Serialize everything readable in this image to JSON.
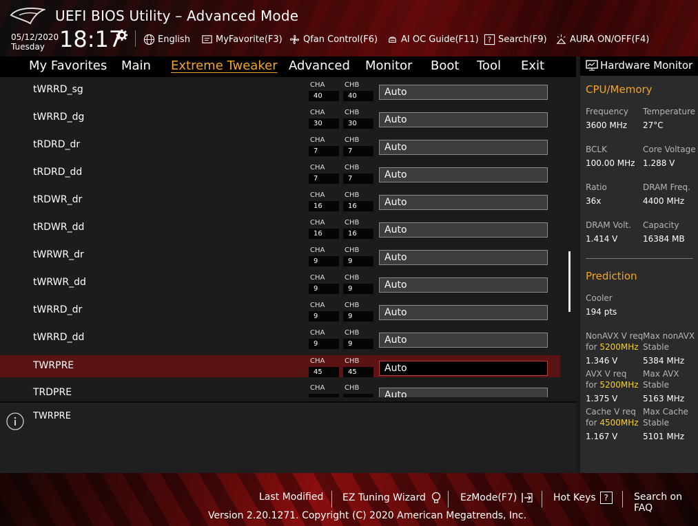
{
  "header": {
    "title": "UEFI BIOS Utility – Advanced Mode",
    "date": "05/12/2020",
    "day": "Tuesday",
    "time": "18:17",
    "toolbar": [
      {
        "label": "English",
        "icon": "globe-icon"
      },
      {
        "label": "MyFavorite(F3)",
        "icon": "favorite-icon"
      },
      {
        "label": "Qfan Control(F6)",
        "icon": "fan-icon"
      },
      {
        "label": "AI OC Guide(F11)",
        "icon": "ai-oc-icon"
      },
      {
        "label": "Search(F9)",
        "icon": "search-help-icon"
      },
      {
        "label": "AURA ON/OFF(F4)",
        "icon": "aura-icon"
      }
    ]
  },
  "menu": {
    "items": [
      "My Favorites",
      "Main",
      "Extreme Tweaker",
      "Advanced",
      "Monitor",
      "Boot",
      "Tool",
      "Exit"
    ],
    "active": "Extreme Tweaker"
  },
  "settings": {
    "cha_label": "CHA",
    "chb_label": "CHB",
    "rows": [
      {
        "name": "tWRRD_sg",
        "cha": "40",
        "chb": "40",
        "value": "Auto"
      },
      {
        "name": "tWRRD_dg",
        "cha": "30",
        "chb": "30",
        "value": "Auto"
      },
      {
        "name": "tRDRD_dr",
        "cha": "7",
        "chb": "7",
        "value": "Auto"
      },
      {
        "name": "tRDRD_dd",
        "cha": "7",
        "chb": "7",
        "value": "Auto"
      },
      {
        "name": "tRDWR_dr",
        "cha": "16",
        "chb": "16",
        "value": "Auto"
      },
      {
        "name": "tRDWR_dd",
        "cha": "16",
        "chb": "16",
        "value": "Auto"
      },
      {
        "name": "tWRWR_dr",
        "cha": "9",
        "chb": "9",
        "value": "Auto"
      },
      {
        "name": "tWRWR_dd",
        "cha": "9",
        "chb": "9",
        "value": "Auto"
      },
      {
        "name": "tWRRD_dr",
        "cha": "9",
        "chb": "9",
        "value": "Auto"
      },
      {
        "name": "tWRRD_dd",
        "cha": "9",
        "chb": "9",
        "value": "Auto"
      },
      {
        "name": "TWRPRE",
        "cha": "45",
        "chb": "45",
        "value": "Auto",
        "selected": true
      },
      {
        "name": "TRDPRE",
        "cha": "",
        "chb": "",
        "value": "Auto"
      }
    ]
  },
  "help": {
    "text": "TWRPRE"
  },
  "hardware_monitor": {
    "title": "Hardware Monitor",
    "cpu_memory": {
      "heading": "CPU/Memory",
      "items": [
        {
          "label": "Frequency",
          "value": "3600 MHz"
        },
        {
          "label": "Temperature",
          "value": "27°C"
        },
        {
          "label": "BCLK",
          "value": "100.00 MHz"
        },
        {
          "label": "Core Voltage",
          "value": "1.288 V"
        },
        {
          "label": "Ratio",
          "value": "36x"
        },
        {
          "label": "DRAM Freq.",
          "value": "4400 MHz"
        },
        {
          "label": "DRAM Volt.",
          "value": "1.414 V"
        },
        {
          "label": "Capacity",
          "value": "16384 MB"
        }
      ]
    },
    "prediction": {
      "heading": "Prediction",
      "cooler_label": "Cooler",
      "cooler_value": "194 pts",
      "nonavx_req_label": "NonAVX V req",
      "for_label": "for",
      "nonavx_freq": "5200MHz",
      "nonavx_volt": "1.346 V",
      "max_nonavx_label": "Max nonAVX",
      "stable_label": "Stable",
      "max_nonavx_value": "5384 MHz",
      "avx_req_label": "AVX V req",
      "avx_freq": "5200MHz",
      "avx_volt": "1.375 V",
      "max_avx_label": "Max AVX",
      "max_avx_value": "5163 MHz",
      "cache_req_label": "Cache V req",
      "cache_freq": "4500MHz",
      "cache_volt": "1.167 V",
      "max_cache_label": "Max Cache",
      "max_cache_value": "5101 MHz"
    }
  },
  "footer": {
    "buttons": [
      "Last Modified",
      "EZ Tuning Wizard",
      "EzMode(F7)",
      "Hot Keys",
      "Search on FAQ"
    ],
    "hotkeys_glyph": "?",
    "copyright": "Version 2.20.1271. Copyright (C) 2020 American Megatrends, Inc."
  },
  "colors": {
    "accent": "#f5a623",
    "selected_row": "#5a1414",
    "highlight": "#f5d020"
  }
}
